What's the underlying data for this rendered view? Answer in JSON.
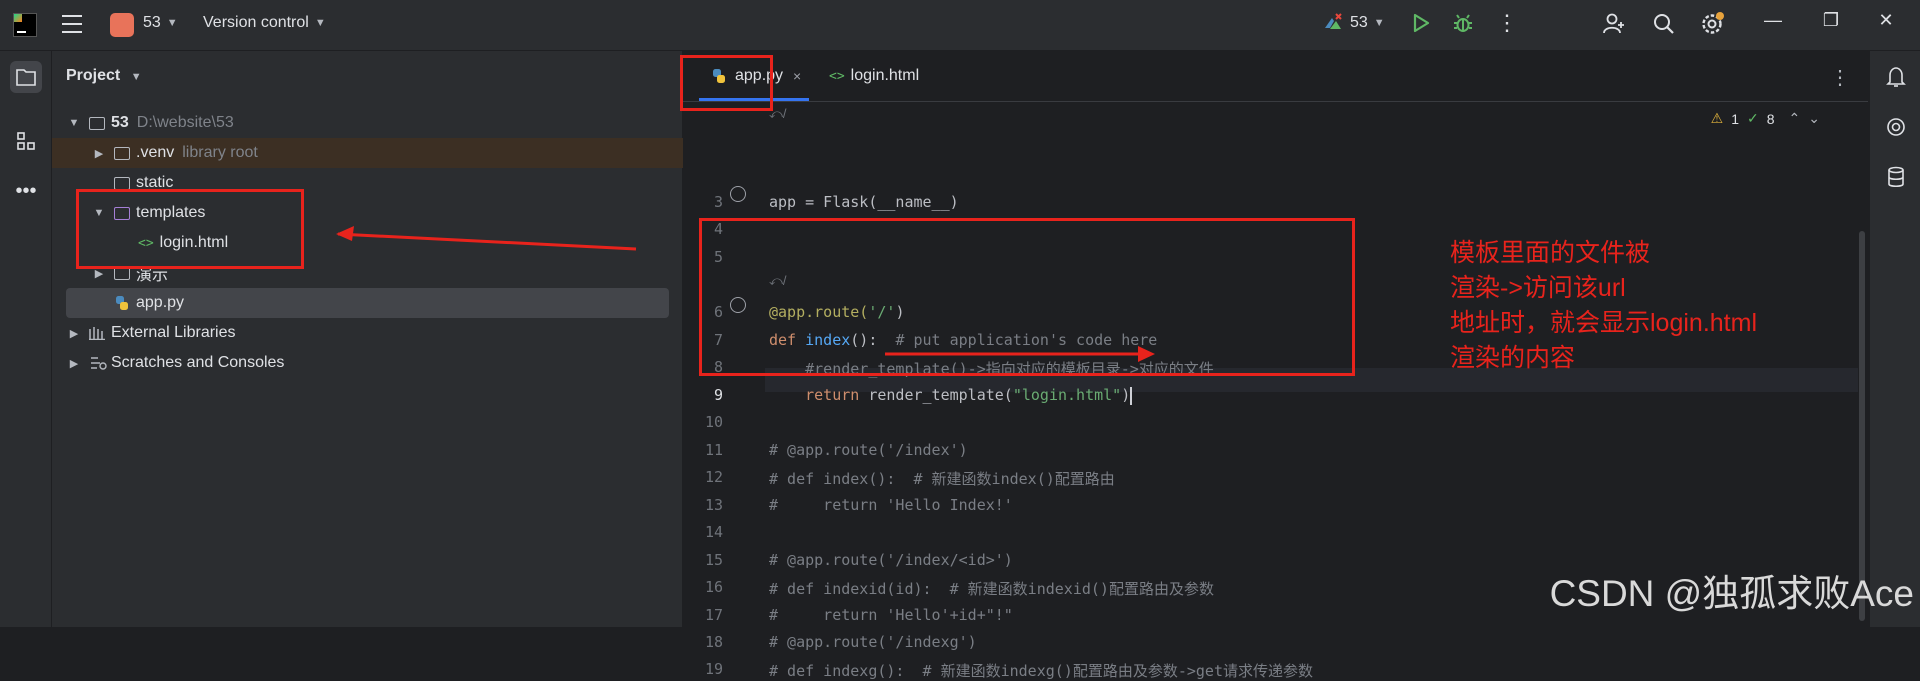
{
  "titlebar": {
    "project_number": "53",
    "vcs_label": "Version control",
    "run_config": "53",
    "colors": {
      "project_badge": "#e8735a",
      "run": "#5fb865"
    }
  },
  "project_panel": {
    "title": "Project",
    "tree": [
      {
        "name": "53",
        "hint": "D:\\website\\53"
      },
      {
        "name": ".venv",
        "hint": "library root"
      },
      {
        "name": "static"
      },
      {
        "name": "templates"
      },
      {
        "name": "login.html"
      },
      {
        "name": "演示"
      },
      {
        "name": "app.py"
      },
      {
        "name": "External Libraries"
      },
      {
        "name": "Scratches and Consoles"
      }
    ]
  },
  "editor": {
    "tabs": [
      {
        "label": "app.py",
        "close": "×"
      },
      {
        "label": "login.html"
      }
    ],
    "inspections": {
      "warnings": "1",
      "checks": "8"
    },
    "lines": {
      "l3": {
        "num": "3",
        "text": "app = Flask(__name__)"
      },
      "l4": {
        "num": "4"
      },
      "l5": {
        "num": "5"
      },
      "l6": {
        "num": "6",
        "decorator": "@app.route(",
        "arg": "'/'",
        "close": ")"
      },
      "l7": {
        "num": "7",
        "kw": "def ",
        "name": "index",
        "rest": "():  ",
        "comment": "# put application's code here"
      },
      "l8": {
        "num": "8",
        "comment": "    #render_template()->指向对应的模板目录->对应的文件"
      },
      "l9": {
        "num": "9",
        "kw": "    return ",
        "call": "render_template(",
        "arg": "\"login.html\"",
        "close": ")"
      },
      "l10": {
        "num": "10"
      },
      "l11": {
        "num": "11",
        "comment": "# @app.route('/index')"
      },
      "l12": {
        "num": "12",
        "comment": "# def index():  # 新建函数index()配置路由"
      },
      "l13": {
        "num": "13",
        "comment": "#     return 'Hello Index!'"
      },
      "l14": {
        "num": "14"
      },
      "l15": {
        "num": "15",
        "comment": "# @app.route('/index/<id>')"
      },
      "l16": {
        "num": "16",
        "comment": "# def indexid(id):  # 新建函数indexid()配置路由及参数"
      },
      "l17": {
        "num": "17",
        "comment": "#     return 'Hello'+id+\"!\""
      },
      "l18": {
        "num": "18",
        "comment": "# @app.route('/indexg')"
      },
      "l19": {
        "num": "19",
        "comment": "# def indexg():  # 新建函数indexg()配置路由及参数->get请求传递参数"
      }
    }
  },
  "annotation": {
    "lines": [
      "模板里面的文件被",
      "渲染->访问该url",
      "地址时，就会显示login.html",
      "渲染的内容"
    ],
    "color": "#e8231c"
  },
  "watermark": "CSDN @独孤求败Ace"
}
